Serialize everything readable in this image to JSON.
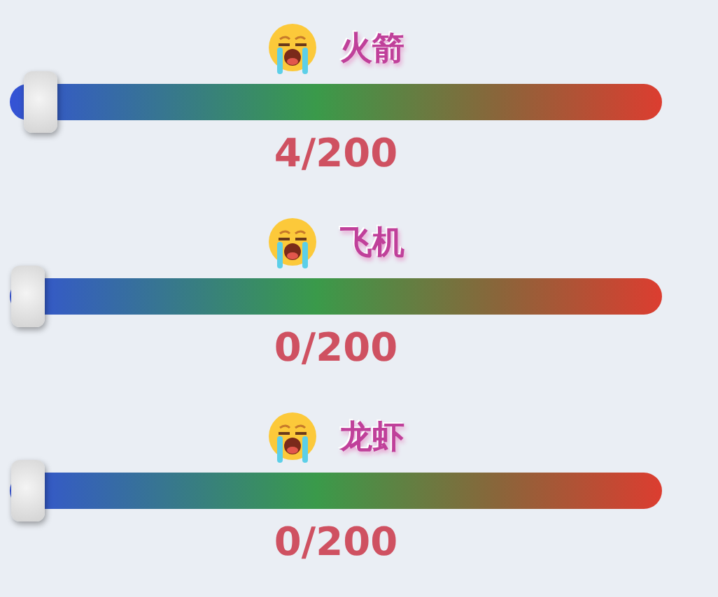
{
  "sliders": [
    {
      "label": "火箭",
      "level": 0.02,
      "reading": "4/200"
    },
    {
      "label": "飞机",
      "level": 0,
      "reading": "0/200"
    },
    {
      "label": "龙虾",
      "level": 0,
      "reading": "0/200"
    }
  ]
}
